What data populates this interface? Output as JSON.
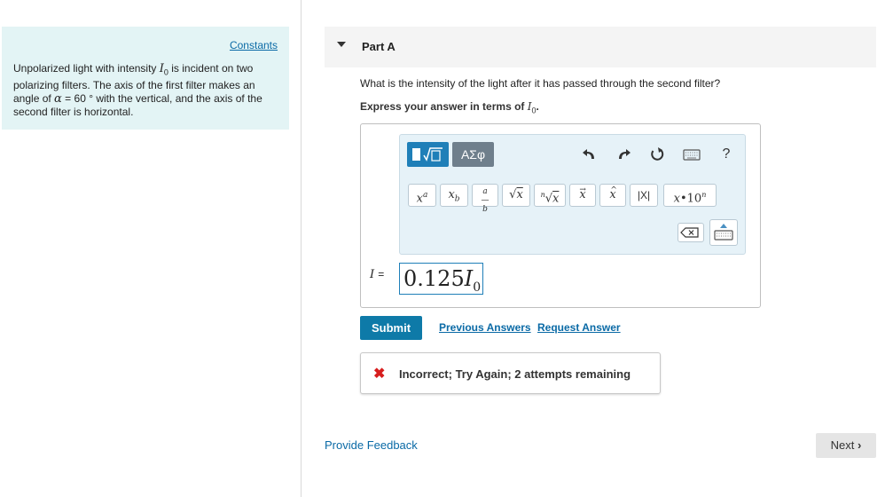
{
  "left_panel": {
    "constants_link": "Constants",
    "problem_text_1": "Unpolarized light with intensity",
    "problem_var_1": "I",
    "problem_sub_1": "0",
    "problem_text_2": "is incident on two polarizing filters. The axis of the first filter makes an angle of",
    "problem_var_2": "α",
    "problem_text_3": "= 60 ° with the vertical, and the axis of the second filter is horizontal."
  },
  "part": {
    "title": "Part A",
    "question": "What is the intensity of the light after it has passed through the second filter?",
    "instruction": "Express your answer in terms of",
    "instruction_var": "I",
    "instruction_sub": "0",
    "instruction_end": "."
  },
  "toolbar": {
    "template_label": "√□",
    "greek_label": "ΑΣφ",
    "undo_icon": "undo-icon",
    "redo_icon": "redo-icon",
    "reset_icon": "reset-icon",
    "keyboard_icon": "keyboard-icon",
    "help_label": "?",
    "templates": [
      "xᵃ",
      "x_b",
      "a/b",
      "√x",
      "ⁿ√x",
      "x⃗",
      "x̂",
      "|x|",
      "x•10ⁿ"
    ],
    "templates_display": {
      "superscript": "xa",
      "subscript": "xb",
      "fraction_num": "a",
      "fraction_den": "b",
      "sqrt": "√x",
      "nthroot": "ⁿ√x",
      "vector": "x",
      "hat": "x",
      "abs": "|x|",
      "sci": "x•10ⁿ"
    }
  },
  "answer": {
    "variable": "I",
    "equals": "=",
    "value_main": "0.125",
    "value_var": "I",
    "value_sub": "0"
  },
  "actions": {
    "submit": "Submit",
    "previous_answers": "Previous Answers",
    "request_answer": "Request Answer"
  },
  "feedback": {
    "status_icon": "x-icon",
    "message": "Incorrect; Try Again; 2 attempts remaining"
  },
  "footer": {
    "provide_feedback": "Provide Feedback",
    "next": "Next"
  },
  "colors": {
    "accent": "#0e7aa8",
    "link": "#0a6aa6",
    "error": "#d71e1e",
    "panel_bg": "#e3f4f5"
  }
}
